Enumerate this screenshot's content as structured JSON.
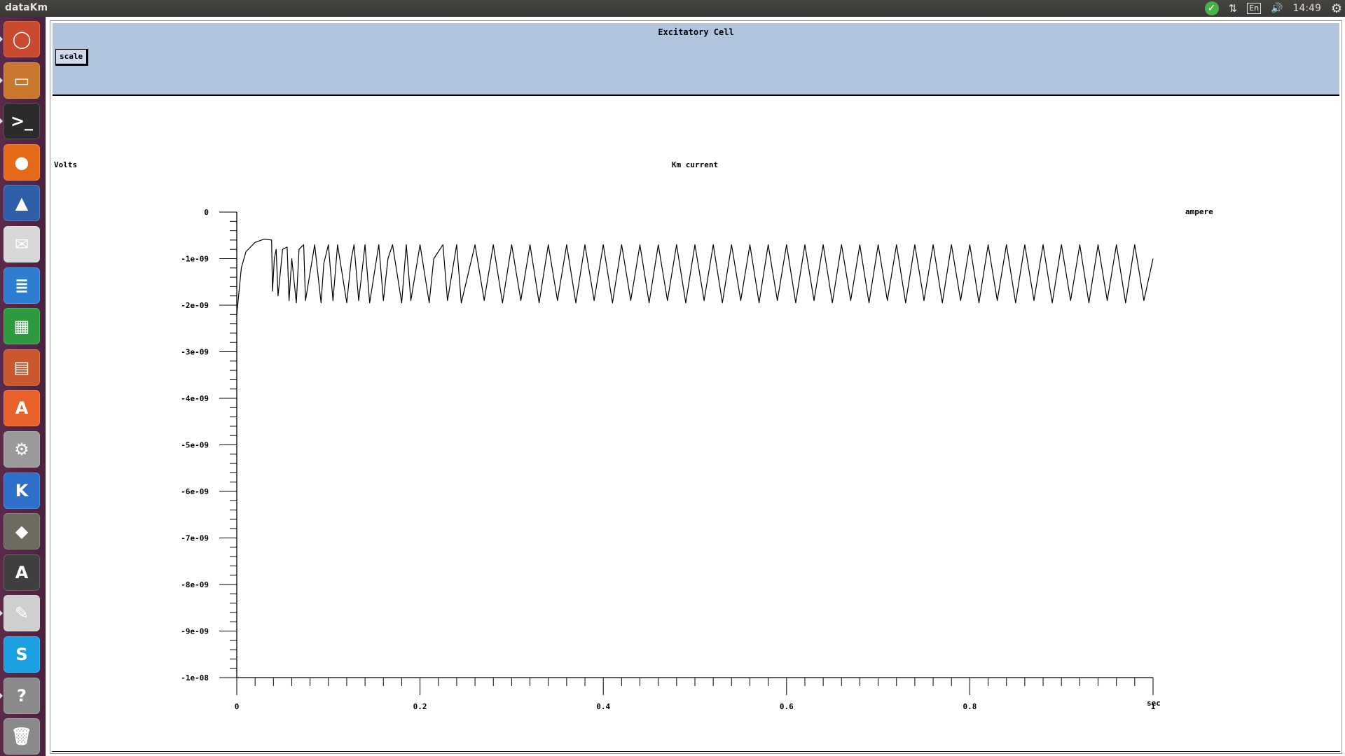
{
  "topbar": {
    "app_title": "dataKm",
    "keyboard_layout": "En",
    "clock": "14:49",
    "icons": [
      "update-ok-icon",
      "network-icon",
      "keyboard-icon",
      "volume-icon",
      "gear-icon"
    ]
  },
  "launcher": {
    "items": [
      {
        "name": "ubuntu-home",
        "icon": "ubuntu-logo-icon",
        "color": "#c94a2e"
      },
      {
        "name": "files",
        "icon": "file-cabinet-icon",
        "color": "#c9772e"
      },
      {
        "name": "terminal",
        "icon": "terminal-icon",
        "color": "#2b2b2b"
      },
      {
        "name": "firefox",
        "icon": "firefox-icon",
        "color": "#e46a1a"
      },
      {
        "name": "matlab",
        "icon": "matlab-icon",
        "color": "#2f5fa8"
      },
      {
        "name": "mail",
        "icon": "envelope-icon",
        "color": "#d8d8d8"
      },
      {
        "name": "writer",
        "icon": "document-icon",
        "color": "#2f7dd1"
      },
      {
        "name": "calc",
        "icon": "spreadsheet-icon",
        "color": "#2e9a3f"
      },
      {
        "name": "impress",
        "icon": "presentation-icon",
        "color": "#c9582e"
      },
      {
        "name": "software-center",
        "icon": "shopping-bag-icon",
        "color": "#e8612a"
      },
      {
        "name": "system-settings",
        "icon": "settings-gear-icon",
        "color": "#9a9a9a"
      },
      {
        "name": "kile",
        "icon": "kile-icon",
        "color": "#2e6fc9"
      },
      {
        "name": "gimp",
        "icon": "gimp-icon",
        "color": "#6d6a60"
      },
      {
        "name": "software-updater",
        "icon": "updater-icon",
        "color": "#3f3f3f"
      },
      {
        "name": "text-editor",
        "icon": "text-editor-icon",
        "color": "#cfcfcf"
      },
      {
        "name": "skype",
        "icon": "skype-icon",
        "color": "#1ba1e2"
      },
      {
        "name": "help",
        "icon": "help-icon",
        "color": "#8a8a8a"
      },
      {
        "name": "trash",
        "icon": "trash-icon",
        "color": "#8a8a8a"
      }
    ],
    "glyphs": [
      "◯",
      "▭",
      ">_",
      "●",
      "▲",
      "✉",
      "≣",
      "▦",
      "▤",
      "A",
      "⚙",
      "K",
      "◆",
      "A",
      "✎",
      "S",
      "?",
      "🗑"
    ]
  },
  "window": {
    "title": "Excitatory Cell",
    "scale_button": "scale"
  },
  "chart_data": {
    "type": "line",
    "title": "Km current",
    "ylabel_left": "Volts",
    "ylabel_right": "ampere",
    "xlabel": "sec",
    "xlim": [
      0,
      1
    ],
    "ylim": [
      -1e-08,
      0
    ],
    "x_tick_labels": [
      "0",
      "0.2",
      "0.4",
      "0.6",
      "0.8",
      "1"
    ],
    "y_tick_labels": [
      "0",
      "-1e-09",
      "-2e-09",
      "-3e-09",
      "-4e-09",
      "-5e-09",
      "-6e-09",
      "-7e-09",
      "-8e-09",
      "-9e-09",
      "-1e-08"
    ],
    "grid": false,
    "legend": "none",
    "series": [
      {
        "x": [
          0,
          0.005,
          0.01,
          0.02,
          0.03,
          0.038,
          0.039,
          0.041,
          0.043,
          0.045,
          0.05,
          0.055,
          0.057,
          0.06,
          0.065,
          0.068,
          0.073,
          0.075,
          0.085,
          0.092,
          0.095,
          0.1,
          0.105,
          0.11,
          0.12,
          0.125,
          0.128,
          0.133,
          0.14,
          0.145,
          0.155,
          0.16,
          0.165,
          0.17,
          0.18,
          0.185,
          0.19,
          0.2,
          0.21,
          0.215,
          0.225,
          0.23,
          0.24,
          0.245,
          0.26,
          0.27,
          0.28,
          0.29,
          0.3,
          0.31,
          0.32,
          0.33,
          0.34,
          0.35,
          0.36,
          0.37,
          0.38,
          0.39,
          0.4,
          0.41,
          0.42,
          0.43,
          0.44,
          0.45,
          0.46,
          0.47,
          0.48,
          0.49,
          0.5,
          0.51,
          0.52,
          0.53,
          0.54,
          0.55,
          0.56,
          0.57,
          0.58,
          0.59,
          0.6,
          0.61,
          0.62,
          0.63,
          0.64,
          0.65,
          0.66,
          0.67,
          0.68,
          0.69,
          0.7,
          0.71,
          0.72,
          0.73,
          0.74,
          0.75,
          0.76,
          0.77,
          0.78,
          0.79,
          0.8,
          0.81,
          0.82,
          0.83,
          0.84,
          0.85,
          0.86,
          0.87,
          0.88,
          0.89,
          0.9,
          0.91,
          0.92,
          0.93,
          0.94,
          0.95,
          0.96,
          0.97,
          0.98,
          0.99,
          1.0
        ],
        "y": [
          -2.2e-09,
          -1.2e-09,
          -8.5e-10,
          -6.5e-10,
          -5.8e-10,
          -6e-10,
          -1.7e-09,
          -1e-09,
          -8e-10,
          -1.8e-09,
          -8e-10,
          -7.5e-10,
          -1.9e-09,
          -1e-09,
          -1.95e-09,
          -8e-10,
          -7e-10,
          -1.9e-09,
          -7e-10,
          -1.95e-09,
          -1.1e-09,
          -7e-10,
          -1.9e-09,
          -7e-10,
          -1.95e-09,
          -1e-09,
          -7e-10,
          -1.9e-09,
          -7e-10,
          -1.95e-09,
          -7e-10,
          -1.9e-09,
          -1e-09,
          -7e-10,
          -1.95e-09,
          -7e-10,
          -1.9e-09,
          -7e-10,
          -1.95e-09,
          -1e-09,
          -7e-10,
          -1.9e-09,
          -7e-10,
          -1.95e-09,
          -7e-10,
          -1.9e-09,
          -7e-10,
          -1.95e-09,
          -7e-10,
          -1.9e-09,
          -7e-10,
          -1.95e-09,
          -7e-10,
          -1.9e-09,
          -7e-10,
          -1.95e-09,
          -7e-10,
          -1.9e-09,
          -7e-10,
          -1.95e-09,
          -7e-10,
          -1.9e-09,
          -7e-10,
          -1.95e-09,
          -7e-10,
          -1.9e-09,
          -7e-10,
          -1.95e-09,
          -7e-10,
          -1.9e-09,
          -7e-10,
          -1.95e-09,
          -7e-10,
          -1.9e-09,
          -7e-10,
          -1.95e-09,
          -7e-10,
          -1.9e-09,
          -7e-10,
          -1.95e-09,
          -7e-10,
          -1.9e-09,
          -7e-10,
          -1.95e-09,
          -7e-10,
          -1.9e-09,
          -7e-10,
          -1.95e-09,
          -7e-10,
          -1.9e-09,
          -7e-10,
          -1.95e-09,
          -7e-10,
          -1.9e-09,
          -7e-10,
          -1.95e-09,
          -7e-10,
          -1.9e-09,
          -7e-10,
          -1.95e-09,
          -7e-10,
          -1.9e-09,
          -7e-10,
          -1.95e-09,
          -7e-10,
          -1.9e-09,
          -7e-10,
          -1.95e-09,
          -7e-10,
          -1.9e-09,
          -7e-10,
          -1.95e-09,
          -7e-10,
          -1.9e-09,
          -7e-10,
          -1.95e-09,
          -7e-10,
          -1.9e-09,
          -1e-09
        ]
      }
    ]
  }
}
